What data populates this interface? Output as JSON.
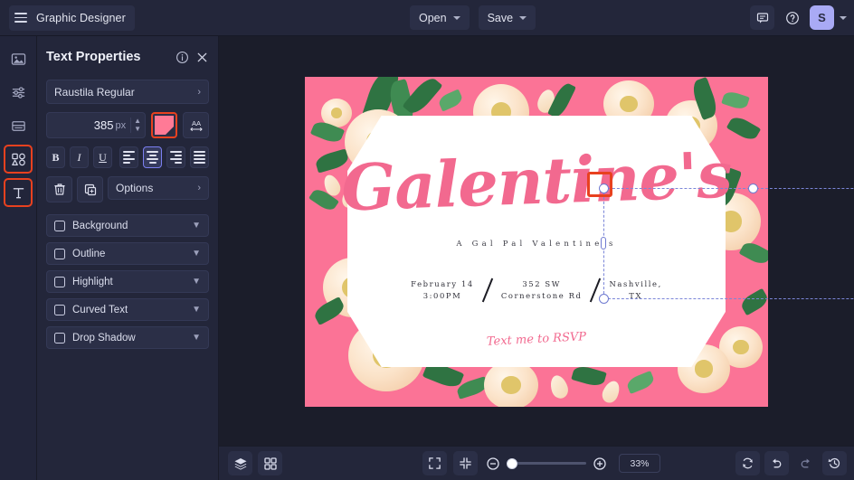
{
  "topbar": {
    "brand": "Graphic Designer",
    "menus": [
      {
        "label": "Open",
        "icon": "chevron-down-icon"
      },
      {
        "label": "Save",
        "icon": "chevron-down-icon"
      }
    ],
    "right_icons": [
      "comment-icon",
      "help-icon"
    ],
    "avatar_initial": "S",
    "avatar_caret": "chevron-down-icon"
  },
  "rail": {
    "items": [
      {
        "name": "image-tool",
        "icon": "image-icon",
        "active": false
      },
      {
        "name": "adjust-tool",
        "icon": "sliders-icon",
        "active": false
      },
      {
        "name": "layout-tool",
        "icon": "layout-icon",
        "active": false
      },
      {
        "name": "shapes-tool",
        "icon": "shapes-icon",
        "active": true
      },
      {
        "name": "text-tool",
        "icon": "text-icon",
        "active": true
      }
    ]
  },
  "panel": {
    "title": "Text Properties",
    "info_icon": "info-icon",
    "close_icon": "close-icon",
    "font_name": "Raustila Regular",
    "font_chevron": "›",
    "font_size": "385",
    "font_size_unit": "px",
    "color_swatch": "#ff7a96",
    "highlight_color": "#e8411f",
    "selected_align": "center",
    "format_buttons": [
      {
        "name": "bold-button",
        "label": "B"
      },
      {
        "name": "italic-button",
        "label": "I"
      },
      {
        "name": "underline-button",
        "label": "U"
      }
    ],
    "align_buttons": [
      "align-left",
      "align-center",
      "align-right",
      "align-justify"
    ],
    "delete_icon": "trash-icon",
    "duplicate_icon": "duplicate-icon",
    "options_label": "Options",
    "options_chevron": "›",
    "spacing_icon": "letter-spacing-icon",
    "toggles": [
      {
        "label": "Background",
        "checked": false
      },
      {
        "label": "Outline",
        "checked": false
      },
      {
        "label": "Highlight",
        "checked": false
      },
      {
        "label": "Curved Text",
        "checked": false
      },
      {
        "label": "Drop Shadow",
        "checked": false
      }
    ]
  },
  "canvas": {
    "background_color": "#fb7396",
    "card": {
      "title": "Galentine's",
      "subtitle": "A Gal Pal Valentine's",
      "details": [
        "February 14\n3:00PM",
        "352 SW\nCornerstone Rd",
        "Nashville,\nTX"
      ],
      "rsvp": "Text me to RSVP"
    }
  },
  "bottombar": {
    "left_icons": [
      "layers-icon",
      "grid-icon"
    ],
    "center_icons": [
      "fit-screen-icon",
      "fit-selection-icon",
      "zoom-out-icon",
      "zoom-in-icon"
    ],
    "zoom_level": "33%",
    "right_icons": [
      "reset-icon",
      "undo-icon",
      "redo-icon",
      "history-icon"
    ]
  }
}
